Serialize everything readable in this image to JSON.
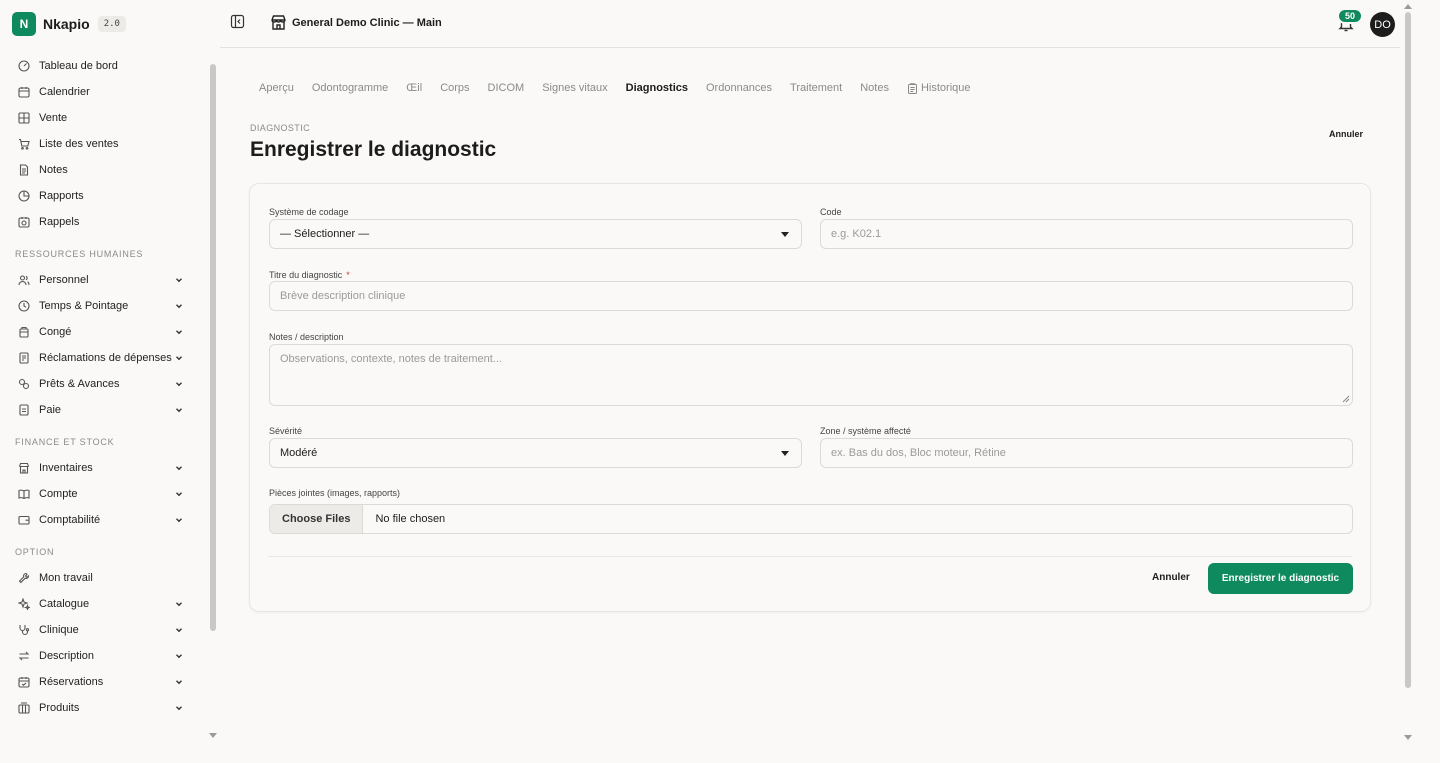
{
  "brand": {
    "logo_letter": "N",
    "name": "Nkapio",
    "version": "2.0"
  },
  "sidebar": {
    "items_top": [
      {
        "label": "Tableau de bord",
        "icon": "dashboard-icon"
      },
      {
        "label": "Calendrier",
        "icon": "calendar-icon"
      },
      {
        "label": "Vente",
        "icon": "grid-icon"
      },
      {
        "label": "Liste des ventes",
        "icon": "cart-icon"
      },
      {
        "label": "Notes",
        "icon": "note-icon"
      },
      {
        "label": "Rapports",
        "icon": "pie-chart-icon"
      },
      {
        "label": "Rappels",
        "icon": "reminder-icon"
      }
    ],
    "section_hr": "RESSOURCES HUMAINES",
    "items_hr": [
      {
        "label": "Personnel",
        "icon": "users-icon"
      },
      {
        "label": "Temps & Pointage",
        "icon": "clock-icon"
      },
      {
        "label": "Congé",
        "icon": "leave-icon"
      },
      {
        "label": "Réclamations de dépenses",
        "icon": "receipt-icon"
      },
      {
        "label": "Prêts & Avances",
        "icon": "coins-icon"
      },
      {
        "label": "Paie",
        "icon": "payslip-icon"
      }
    ],
    "section_fin": "FINANCE ET STOCK",
    "items_fin": [
      {
        "label": "Inventaires",
        "icon": "store-icon"
      },
      {
        "label": "Compte",
        "icon": "book-icon"
      },
      {
        "label": "Comptabilité",
        "icon": "wallet-icon"
      }
    ],
    "section_opt": "OPTION",
    "items_opt": [
      {
        "label": "Mon travail",
        "icon": "wrench-icon"
      },
      {
        "label": "Catalogue",
        "icon": "sparkle-icon"
      },
      {
        "label": "Clinique",
        "icon": "stethoscope-icon"
      },
      {
        "label": "Description",
        "icon": "swap-icon"
      },
      {
        "label": "Réservations",
        "icon": "calendar-check-icon"
      },
      {
        "label": "Produits",
        "icon": "boxes-icon"
      }
    ]
  },
  "header": {
    "clinic_name": "General Demo Clinic — Main",
    "notification_count": "50",
    "avatar_initials": "DO"
  },
  "tabs": [
    {
      "label": "Aperçu",
      "active": false
    },
    {
      "label": "Odontogramme",
      "active": false
    },
    {
      "label": "Œil",
      "active": false
    },
    {
      "label": "Corps",
      "active": false
    },
    {
      "label": "DICOM",
      "active": false
    },
    {
      "label": "Signes vitaux",
      "active": false
    },
    {
      "label": "Diagnostics",
      "active": true
    },
    {
      "label": "Ordonnances",
      "active": false
    },
    {
      "label": "Traitement",
      "active": false
    },
    {
      "label": "Notes",
      "active": false
    },
    {
      "label": "Historique",
      "active": false,
      "icon": "clipboard-icon"
    }
  ],
  "page": {
    "kicker": "DIAGNOSTIC",
    "title": "Enregistrer le diagnostic",
    "top_cancel": "Annuler"
  },
  "form": {
    "coding_system": {
      "label": "Système de codage",
      "value": "— Sélectionner —"
    },
    "code": {
      "label": "Code",
      "placeholder": "e.g. K02.1"
    },
    "title": {
      "label": "Titre du diagnostic",
      "required_mark": "*",
      "placeholder": "Brève description clinique"
    },
    "notes": {
      "label": "Notes / description",
      "placeholder": "Observations, contexte, notes de traitement..."
    },
    "severity": {
      "label": "Sévérité",
      "value": "Modéré"
    },
    "zone": {
      "label": "Zone / système affecté",
      "placeholder": "ex. Bas du dos, Bloc moteur, Rétine"
    },
    "attachments": {
      "label": "Pièces jointes (images, rapports)",
      "button": "Choose Files",
      "status": "No file chosen"
    },
    "cancel_label": "Annuler",
    "submit_label": "Enregistrer le diagnostic"
  },
  "colors": {
    "accent": "#0f8a5f",
    "background": "#faf9f7",
    "muted_text": "#8a8a8a"
  }
}
